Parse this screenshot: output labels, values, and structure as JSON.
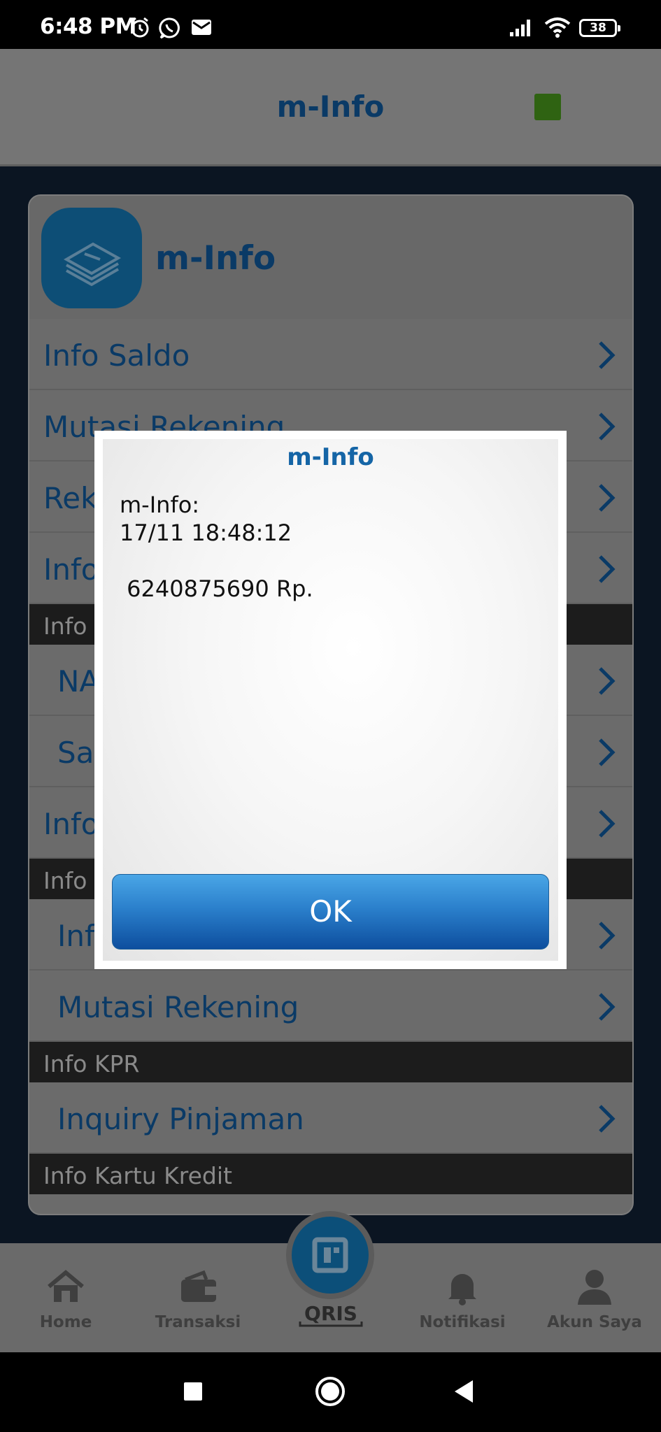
{
  "status_bar": {
    "time": "6:48 PM",
    "battery": "38",
    "icons": [
      "alarm-icon",
      "whatsapp-icon",
      "mail-icon",
      "signal-icon",
      "wifi-icon",
      "battery-icon"
    ]
  },
  "header": {
    "title": "m-Info",
    "status_indicator_color": "#2f6312"
  },
  "card": {
    "title": "m-Info",
    "logo_icon": "money-stack-icon"
  },
  "menu": {
    "info_saldo": "Info Saldo",
    "mutasi_rekening_1": "Mutasi Rekening",
    "rek_partial": "Rek",
    "info_partial_1": "Info",
    "section_1_partial": "Info I",
    "na_partial": "NA",
    "sa_partial": "Sal",
    "info_partial_2": "Info",
    "section_2_partial": "Info I",
    "inf_partial": "Inf",
    "mutasi_rekening_2": "Mutasi Rekening",
    "section_kpr": "Info KPR",
    "inquiry_pinjaman": "Inquiry Pinjaman",
    "section_kartu_kredit": "Info Kartu Kredit"
  },
  "bottom_nav": {
    "home": "Home",
    "transaksi": "Transaksi",
    "qris": "QRIS",
    "notifikasi": "Notifikasi",
    "akun_saya": "Akun Saya"
  },
  "dialog": {
    "title": "m-Info",
    "message": "m-Info:\n17/11 18:48:12\n\n 6240875690 Rp.",
    "ok_label": "OK"
  },
  "colors": {
    "brand_blue": "#0a3a66",
    "dialog_title": "#1565a6",
    "ok_button": "#2b80cc"
  }
}
